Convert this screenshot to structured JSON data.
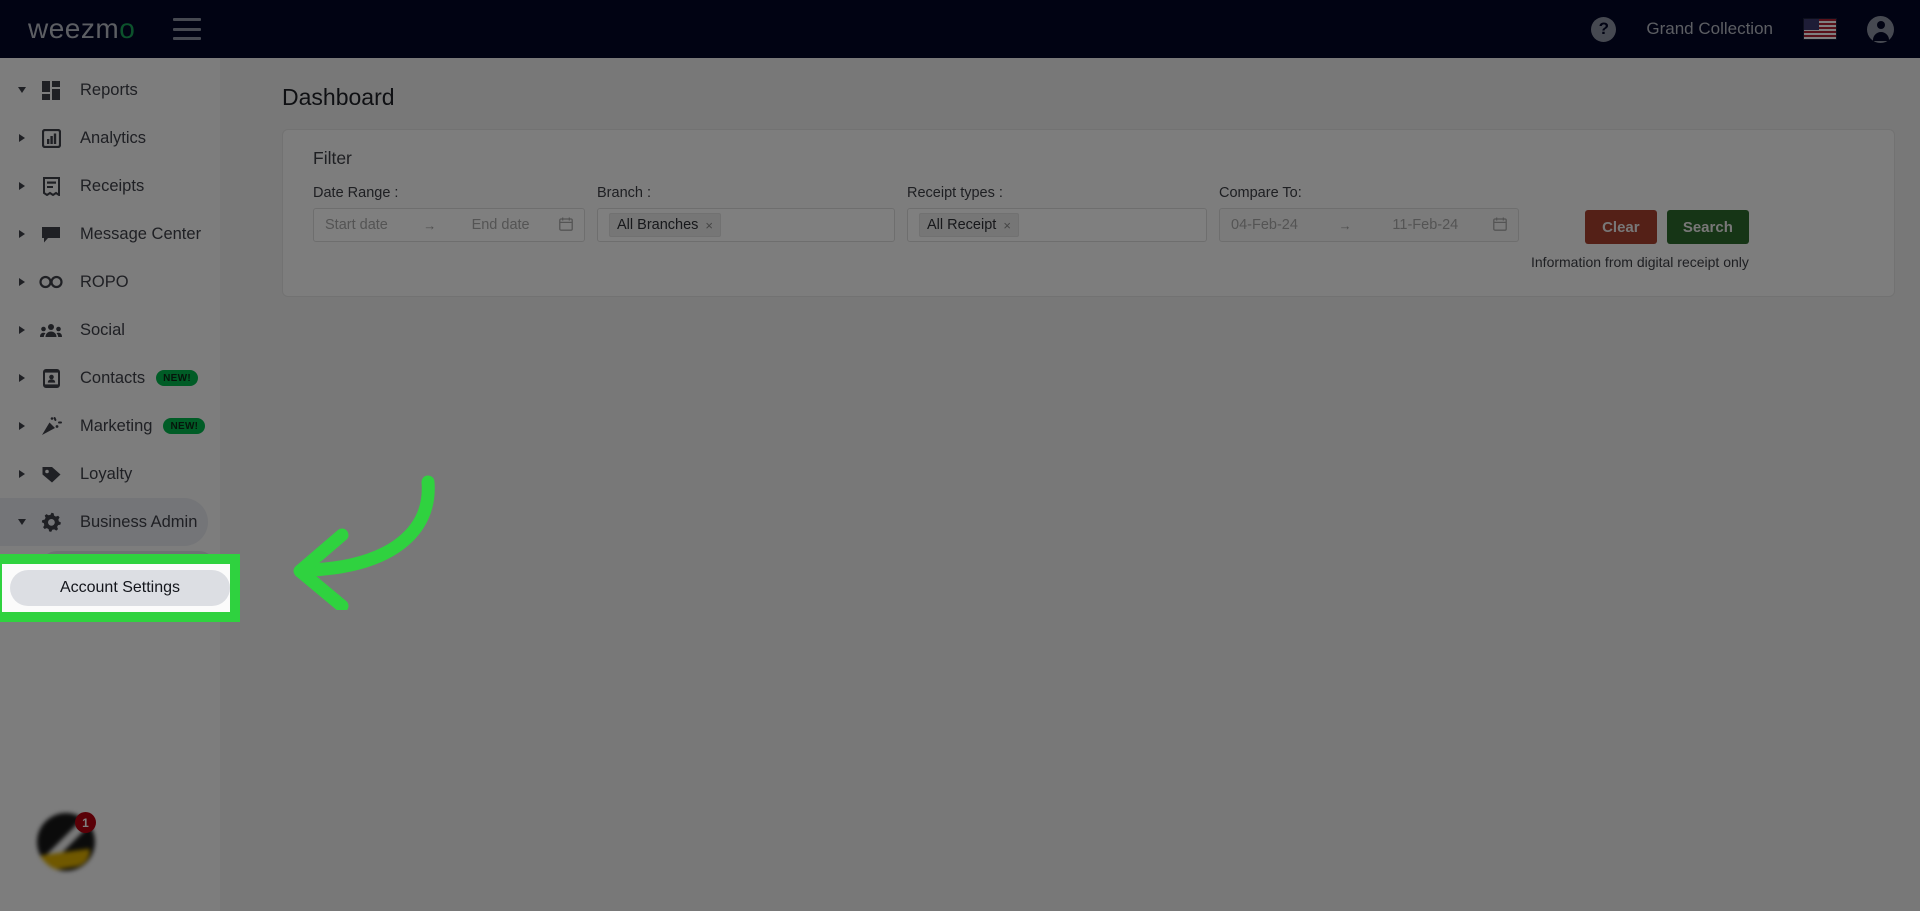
{
  "topbar": {
    "logo_main": "weezm",
    "logo_accent": "o",
    "menu_icon": "hamburger-menu-icon",
    "help_icon": "?",
    "account_name": "Grand Collection",
    "flag_icon": "us-flag-icon",
    "avatar_icon": "account-avatar-icon"
  },
  "sidebar": {
    "items": [
      {
        "label": "Reports",
        "icon": "dashboard-grid-icon",
        "expanded": true,
        "badge": ""
      },
      {
        "label": "Analytics",
        "icon": "bar-chart-icon",
        "expanded": false,
        "badge": ""
      },
      {
        "label": "Receipts",
        "icon": "receipt-icon",
        "expanded": false,
        "badge": ""
      },
      {
        "label": "Message Center",
        "icon": "chat-bubble-icon",
        "expanded": false,
        "badge": ""
      },
      {
        "label": "ROPO",
        "icon": "infinity-icon",
        "expanded": false,
        "badge": ""
      },
      {
        "label": "Social",
        "icon": "people-group-icon",
        "expanded": false,
        "badge": ""
      },
      {
        "label": "Contacts",
        "icon": "contact-card-icon",
        "expanded": false,
        "badge": "NEW!"
      },
      {
        "label": "Marketing",
        "icon": "party-popper-icon",
        "expanded": false,
        "badge": "NEW!"
      },
      {
        "label": "Loyalty",
        "icon": "tag-icon",
        "expanded": false,
        "badge": ""
      },
      {
        "label": "Business Admin",
        "icon": "gear-icon",
        "expanded": true,
        "badge": ""
      }
    ],
    "submenu": [
      {
        "label": "Account Settings"
      }
    ],
    "chat_badge_count": "1",
    "chat_avatar_icon": "chat-avatar-n-icon"
  },
  "main": {
    "page_title": "Dashboard",
    "filter": {
      "title": "Filter",
      "date_range": {
        "label": "Date Range :",
        "start_placeholder": "Start date",
        "end_placeholder": "End date",
        "separator": "→",
        "calendar_icon": "calendar-icon"
      },
      "branch": {
        "label": "Branch :",
        "tag": "All Branches",
        "tag_remove": "×"
      },
      "receipt_types": {
        "label": "Receipt types :",
        "tag": "All Receipt",
        "tag_remove": "×"
      },
      "compare_to": {
        "label": "Compare To:",
        "start_value": "04-Feb-24",
        "end_value": "11-Feb-24",
        "separator": "→",
        "calendar_icon": "calendar-icon"
      },
      "clear_label": "Clear",
      "search_label": "Search",
      "note": "Information from digital receipt only"
    }
  },
  "annotations": {
    "highlight_label": "Account Settings",
    "arrow_icon": "curved-left-arrow-icon",
    "highlight_color": "#2fd23f",
    "arrow_color": "#2fd23f"
  },
  "colors": {
    "topbar_bg": "#030626",
    "logo_accent": "#18a558",
    "badge_new_bg": "#00b84c",
    "clear_btn": "#a8402f",
    "search_btn": "#2d6b2d",
    "notification_badge": "#b4000f"
  }
}
